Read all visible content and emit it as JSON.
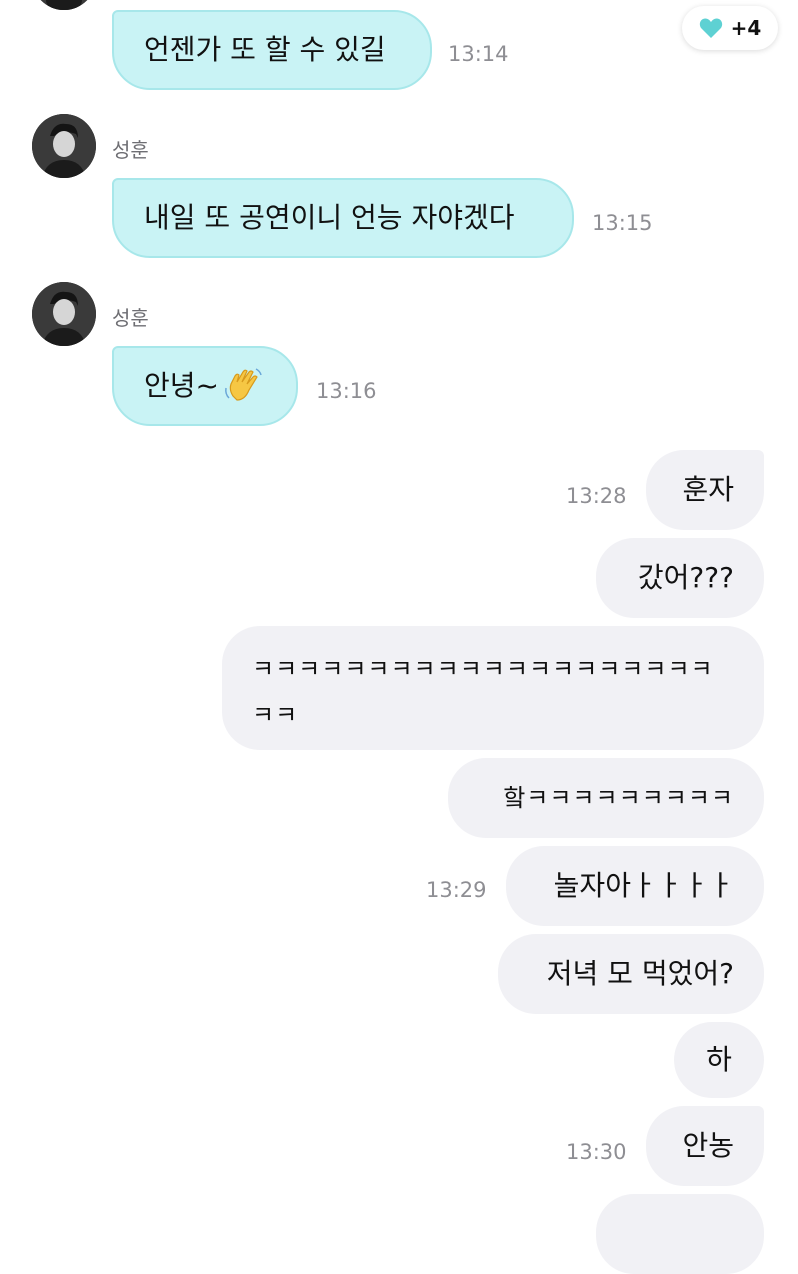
{
  "chat": {
    "reaction": {
      "icon": "heart-icon",
      "count": "+4",
      "heart_color": "#5ed1d3"
    },
    "messages": [
      {
        "id": "m1",
        "text": "언젠가 또 할 수 있길",
        "time": "13:14"
      },
      {
        "id": "m2",
        "sender": "성훈",
        "text": "내일 또 공연이니 언능 자야겠다",
        "time": "13:15"
      },
      {
        "id": "m3",
        "sender": "성훈",
        "text": "안녕~",
        "emoji": "waving-hand-icon",
        "time": "13:16"
      },
      {
        "id": "r1",
        "text": "훈자",
        "time": "13:28"
      },
      {
        "id": "r2",
        "text": "갔어???"
      },
      {
        "id": "r3",
        "line1": "ㅋㅋㅋㅋㅋㅋㅋㅋㅋㅋㅋㅋㅋㅋㅋㅋㅋㅋㅋㅋ",
        "line2": "ㅋㅋ"
      },
      {
        "id": "r4",
        "text": "핰ㅋㅋㅋㅋㅋㅋㅋㅋㅋ"
      },
      {
        "id": "r5",
        "text": "놀자아ㅏㅏㅏㅏ",
        "time": "13:29"
      },
      {
        "id": "r6",
        "text": "저녁 모 먹었어?"
      },
      {
        "id": "r7",
        "text": "하"
      },
      {
        "id": "r8",
        "text": "안농",
        "time": "13:30"
      }
    ]
  },
  "colors": {
    "incoming_bubble": "#c9f3f5",
    "outgoing_bubble": "#f1f1f5"
  }
}
